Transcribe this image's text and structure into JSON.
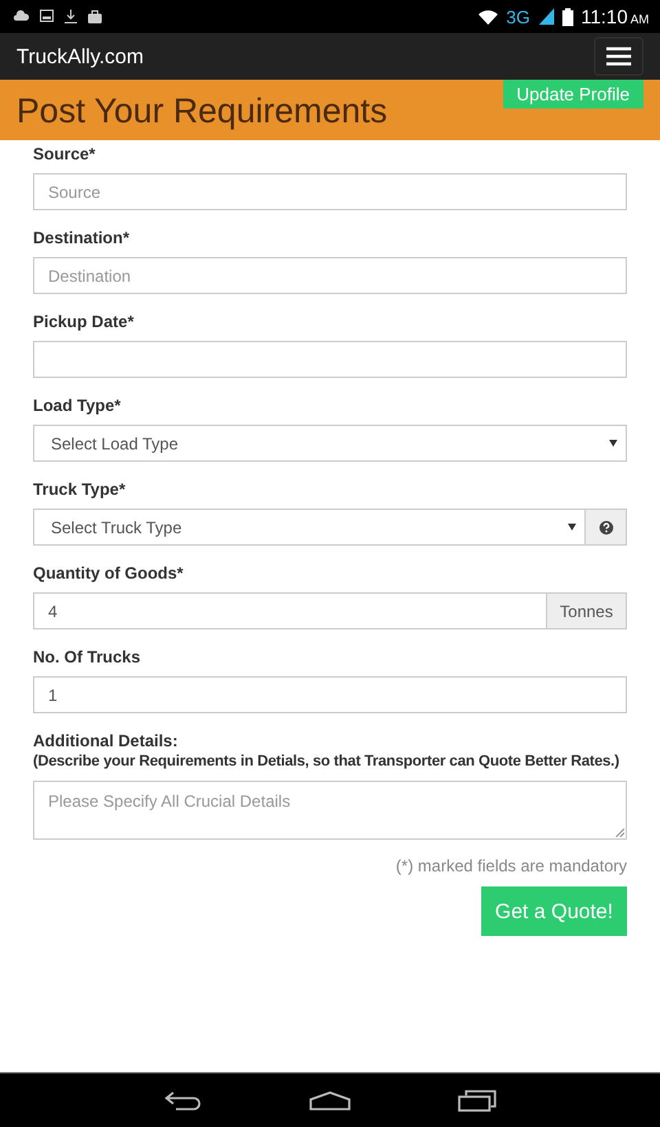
{
  "status_bar": {
    "network": "3G",
    "time": "11:10",
    "period": "AM"
  },
  "navbar": {
    "brand": "TruckAlly.com"
  },
  "header": {
    "title": "Post Your Requirements",
    "action": "Update Profile"
  },
  "fields": [
    {
      "kind": "text",
      "label": "Source*",
      "placeholder": "Source"
    },
    {
      "kind": "text",
      "label": "Destination*",
      "placeholder": "Destination"
    },
    {
      "kind": "text",
      "label": "Pickup Date*"
    },
    {
      "kind": "select",
      "label": "Load Type*",
      "value": "Select Load Type"
    },
    {
      "kind": "select-help",
      "label": "Truck Type*",
      "value": "Select Truck Type"
    },
    {
      "kind": "addon",
      "label": "Quantity of Goods*",
      "value": "4",
      "addon": "Tonnes"
    },
    {
      "kind": "text",
      "label": "No. Of Trucks",
      "value": "1"
    },
    {
      "kind": "textarea",
      "label": "Additional Details:",
      "note": "(Describe your Requirements in Detials, so that Transporter can Quote Better Rates.)",
      "placeholder": "Please Specify All Crucial Details"
    }
  ],
  "footer": {
    "note": "(*) marked fields are mandatory",
    "submit": "Get a Quote!"
  }
}
